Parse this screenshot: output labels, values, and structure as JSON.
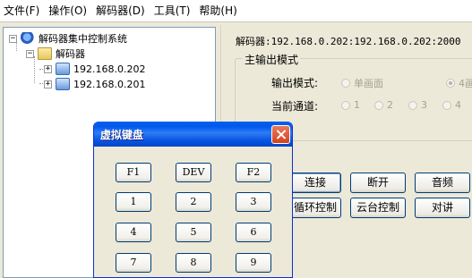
{
  "menu": [
    "文件(F)",
    "操作(O)",
    "解码器(D)",
    "工具(T)",
    "帮助(H)"
  ],
  "tree": {
    "root": "解码器集中控制系统",
    "group": "解码器",
    "devices": [
      "192.168.0.202",
      "192.168.0.201"
    ]
  },
  "right": {
    "decoder_info": "解码器:192.168.0.202:192.168.0.202:2000",
    "main_output": {
      "group_title": "主输出模式",
      "output_mode_label": "输出模式:",
      "mode_single": "单画面",
      "mode_four": "4画",
      "channel_label": "当前通道:",
      "channels": [
        "1",
        "2",
        "3",
        "4"
      ]
    },
    "buttons": {
      "connect": "连接",
      "disconnect": "断开",
      "audio": "音频",
      "loop_control": "循环控制",
      "ptz_control": "云台控制",
      "intercom": "对讲"
    }
  },
  "keyboard": {
    "title": "虚拟键盘",
    "keys": [
      "F1",
      "DEV",
      "F2",
      "1",
      "2",
      "3",
      "4",
      "5",
      "6",
      "7",
      "8",
      "9"
    ]
  }
}
